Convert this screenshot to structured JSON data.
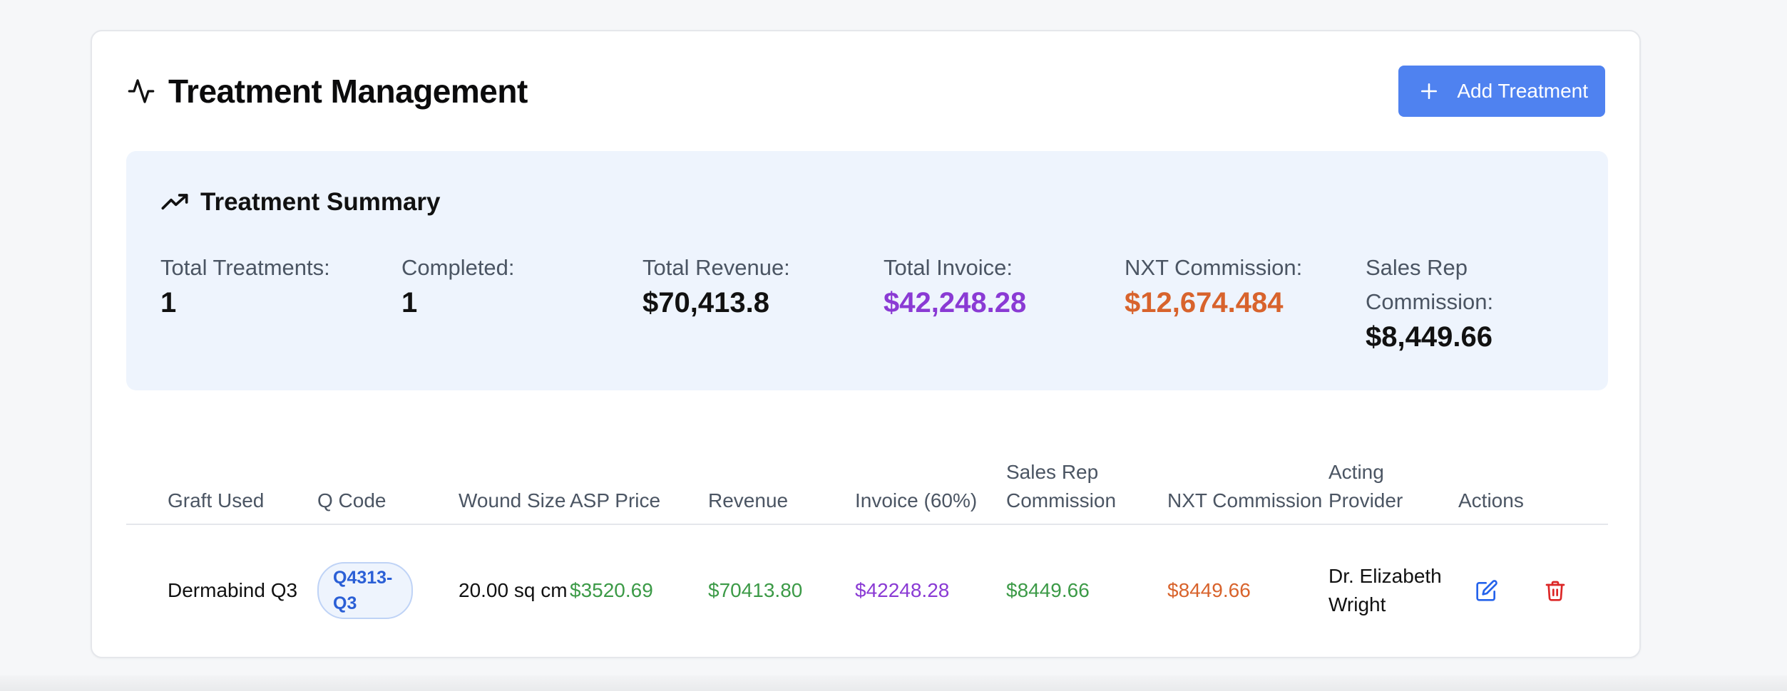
{
  "header": {
    "title": "Treatment Management",
    "add_button_label": "Add Treatment"
  },
  "summary": {
    "title": "Treatment Summary",
    "stats": [
      {
        "label": "Total Treatments:",
        "value": "1"
      },
      {
        "label": "Completed:",
        "value": "1"
      },
      {
        "label": "Total Revenue:",
        "value": "$70,413.8"
      },
      {
        "label": "Total Invoice:",
        "value": "$42,248.28"
      },
      {
        "label": "NXT Commission:",
        "value": "$12,674.484"
      },
      {
        "label": "Sales Rep Commission:",
        "value": "$8,449.66"
      }
    ]
  },
  "table": {
    "columns": {
      "graft": "Graft Used",
      "qcode": "Q Code",
      "wound": "Wound Size",
      "asp": "ASP Price",
      "revenue": "Revenue",
      "invoice": "Invoice (60%)",
      "sales_rep": "Sales Rep Commission",
      "nxt": "NXT Commission",
      "provider": "Acting Provider",
      "actions": "Actions"
    },
    "rows": [
      {
        "graft": "Dermabind Q3",
        "qcode": "Q4313-Q3",
        "wound": "20.00 sq cm",
        "asp": "$3520.69",
        "revenue": "$70413.80",
        "invoice": "$42248.28",
        "sales_rep": "$8449.66",
        "nxt": "$8449.66",
        "provider": "Dr. Elizabeth Wright"
      }
    ]
  },
  "colors": {
    "accent": "#4f82f0",
    "green": "#3c9a47",
    "purple": "#8a3ad4",
    "orange": "#d8632c",
    "danger": "#dc2626",
    "edit": "#2563eb"
  },
  "icons": {
    "title": "activity-icon",
    "add": "plus-icon",
    "summary": "trending-up-icon",
    "edit": "edit-icon",
    "delete": "trash-icon"
  }
}
